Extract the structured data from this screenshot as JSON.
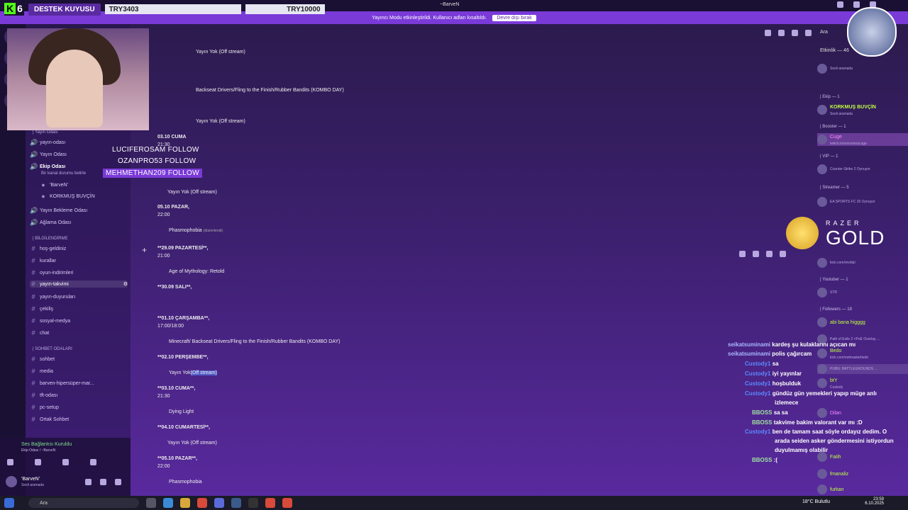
{
  "window": {
    "title": "~BarveN"
  },
  "notice": {
    "text": "Yayıncı Modu etkinleştirildi. Kullanıcı adları kısaltıldı.",
    "button": "Devre dışı bırak"
  },
  "donation": {
    "label": "DESTEK KUYUSU",
    "current": "TRY3403",
    "goal": "TRY10000",
    "logo_num": "6"
  },
  "overlay": {
    "follows": [
      "LUCIFEROSAM  FOLLOW",
      "OZANPRO53  FOLLOW",
      "MEHMETHAN209  FOLLOW"
    ],
    "gold": "GOLD",
    "razer": "RAZER"
  },
  "sidebar": {
    "voice_cat": "| Yayın Odası",
    "voice": [
      "yayın-odası",
      "Yayın Odası",
      "Ekip Odası",
      "Yayın Bekleme Odası",
      "Ağlama Odası"
    ],
    "ekip_status": "Bir kanal durumu belirle",
    "ekip_users": [
      "'BarveN'",
      "KORKMUŞ BUVÇİN"
    ],
    "info_cat": "| BİLGİLENDİRME",
    "info": [
      "hoş-geldiniz",
      "kurallar",
      "oyun-indirimleri",
      "yayın-takvimi",
      "yayın-duyuruları",
      "çekiliş",
      "sosyal-medya",
      "chat"
    ],
    "chat_cat": "| SOHBET ODALARI",
    "chatrooms": [
      "sohbet",
      "media",
      "barven-hipersüper-mar...",
      "tft-odası",
      "pc-setup",
      "Ortak Sohbet"
    ],
    "voice_status": "Ses Bağlantısı Kuruldu",
    "voice_channel": "Ekip Odası / ~BarveN",
    "user": "'BarveN'",
    "user_status": "Sesli aramada"
  },
  "header": {
    "search": "Ara",
    "event": "Etkinlik — 46"
  },
  "messages": {
    "m1": "Yayın Yok (Off stream)",
    "m2": "Backseat Drivers/Fling to the Finish/Rubber Bandits (KOMBO DAY)",
    "m3": "Yayın Yok (Off stream)",
    "m4": "03.10 CUMA",
    "m5": "21:30",
    "m6": "Yayın Yok (Off stream)",
    "m7": "05.10  PAZAR,",
    "m8": "22:00",
    "m9": "Phasmophobia",
    "m9b": "(düzenlendi)",
    "p1": "**29.09  PAZARTESİ**,",
    "p2": "21:00",
    "p3": "Age of Mythology: Retold",
    "p4": "**30.09 SALI**,",
    "p5": "**01.10 ÇARŞAMBA**,",
    "p6": "17:00/18:00",
    "p7": "Minecraft/ Backseat Drivers/Fling to the Finish/Rubber Bandits (KOMBO DAY)",
    "p8": "**02.10 PERŞEMBE**,",
    "p9": "Yayın Yok",
    "p9sel": "(Off stream)",
    "p10": "**03.10 CUMA**,",
    "p11": "21:30",
    "p12": "Dying Light",
    "p13": "**04.10 CUMARTESİ**,",
    "p14": "Yayın Yok (Off stream)",
    "p15": "**05.10  PAZAR**,",
    "p16": "22:00",
    "p17": "Phasmophobia"
  },
  "members": {
    "groups": [
      "| Ekip — 1",
      "| Booster — 1",
      "| VIP — 1",
      "| Streamer — 5",
      "| Youtuber — 1",
      "| Followers — 18"
    ],
    "korkmus": "KORKMUŞ BUVÇİN",
    "korkmus_sub": "Sesli aramada",
    "top_sub": "Sesli aramada",
    "cuge": "Cuge",
    "cuge_sub": "twitch.tv/sorceresscuge",
    "vip_sub": "Counter-Strike 2 Oynuyor",
    "streamer_sub": "EA SPORTS FC 26 Oynuyor",
    "kick": "kick.com/revidal",
    "yt": "STR",
    "f1": "abi bana higggg",
    "f2": "Path of Exile 2 <PoE Overlay ...",
    "bedo": "Bedo",
    "bedo_sub": "kick.com/notmasterbedo",
    "pubg": "PUBG: BATTLEGROUNDS ...",
    "bty": "btY",
    "custody": "Custody",
    "dilan": "Dilan",
    "fatih": "Fatih",
    "fmanaliz": "fmanaliz",
    "furkan": "furkan"
  },
  "chat": [
    {
      "u": "seikatsuminami",
      "t": "kardeş şu kulaklarını açıcan mı"
    },
    {
      "u": "seikatsuminami",
      "t": "polis çağırcam"
    },
    {
      "u": "Custody1",
      "t": "sa"
    },
    {
      "u": "Custody1",
      "t": "iyi yayınlar"
    },
    {
      "u": "Custody1",
      "t": "hoşbulduk"
    },
    {
      "u": "Custody1",
      "t": "gündüz gün yemekleri yapıp müge anlı"
    },
    {
      "u": "",
      "t": "izlemece"
    },
    {
      "u": "BBOSS",
      "t": "sa sa"
    },
    {
      "u": "BBOSS",
      "t": "takvime bakim valorant var mı :D"
    },
    {
      "u": "Custody1",
      "t": "ben de tamam saat söyle ordayız dedim. O"
    },
    {
      "u": "",
      "t": "arada seiden asker göndermesini istiyordun"
    },
    {
      "u": "",
      "t": "duyulmamış olabilir"
    },
    {
      "u": "BBOSS",
      "t": ":("
    }
  ],
  "taskbar": {
    "search": "Ara",
    "weather": "18°C  Bulutlu",
    "time": "23:59",
    "date": "6.10.2025"
  },
  "colors": {
    "accent": "#7a3ad8",
    "kick": "#53fc18"
  }
}
